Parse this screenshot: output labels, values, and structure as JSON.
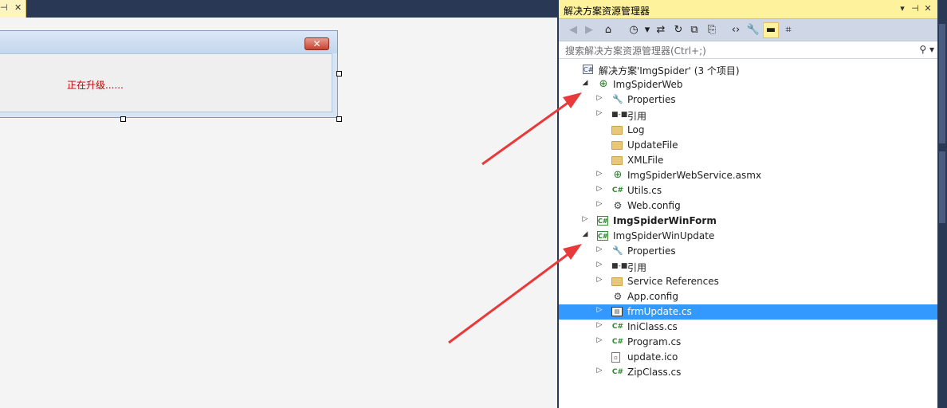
{
  "editor": {
    "tab_pin": "⊣",
    "tab_close": "✕",
    "form": {
      "close_button": "✕",
      "status_text": "正在升级......"
    }
  },
  "solution_explorer": {
    "title": "解决方案资源管理器",
    "title_buttons": {
      "dropdown": "▾",
      "pin": "⊣",
      "close": "✕"
    },
    "toolbar": [
      {
        "name": "back-icon",
        "glyph": "◀",
        "enabled": false
      },
      {
        "name": "forward-icon",
        "glyph": "▶",
        "enabled": false
      },
      {
        "name": "home-icon",
        "glyph": "⌂",
        "enabled": true
      },
      {
        "name": "pending-changes-icon",
        "glyph": "◷",
        "enabled": true
      },
      {
        "name": "dropdown-arrow-icon",
        "glyph": "▾",
        "enabled": true
      },
      {
        "name": "sync-icon",
        "glyph": "⇄",
        "enabled": true
      },
      {
        "name": "refresh-icon",
        "glyph": "↻",
        "enabled": true
      },
      {
        "name": "collapse-all-icon",
        "glyph": "⧉",
        "enabled": true
      },
      {
        "name": "show-all-files-icon",
        "glyph": "⎘",
        "enabled": true
      },
      {
        "name": "view-code-icon",
        "glyph": "‹›",
        "enabled": true
      },
      {
        "name": "properties-wrench-icon",
        "glyph": "🔧",
        "enabled": true
      },
      {
        "name": "preview-icon",
        "glyph": "▬",
        "enabled": true,
        "active": true
      },
      {
        "name": "class-diagram-icon",
        "glyph": "⌗",
        "enabled": true
      }
    ],
    "search": {
      "placeholder": "搜索解决方案资源管理器(Ctrl+;)",
      "icon": "⚲",
      "dropdown": "▾"
    },
    "tree": [
      {
        "label": "解决方案'ImgSpider' (3 个项目)",
        "level": 0,
        "icon": "solution",
        "expander": ""
      },
      {
        "label": "ImgSpiderWeb",
        "level": 1,
        "icon": "web",
        "expander": "◢"
      },
      {
        "label": "Properties",
        "level": 2,
        "icon": "wrench",
        "expander": "▷"
      },
      {
        "label": "引用",
        "level": 2,
        "icon": "references",
        "expander": "▷"
      },
      {
        "label": "Log",
        "level": 2,
        "icon": "folder",
        "expander": ""
      },
      {
        "label": "UpdateFile",
        "level": 2,
        "icon": "folder",
        "expander": ""
      },
      {
        "label": "XMLFile",
        "level": 2,
        "icon": "folder",
        "expander": ""
      },
      {
        "label": "ImgSpiderWebService.asmx",
        "level": 2,
        "icon": "asmx",
        "expander": "▷"
      },
      {
        "label": "Utils.cs",
        "level": 2,
        "icon": "cs",
        "expander": "▷"
      },
      {
        "label": "Web.config",
        "level": 2,
        "icon": "config",
        "expander": "▷"
      },
      {
        "label": "ImgSpiderWinForm",
        "level": 1,
        "icon": "csproj",
        "expander": "▷",
        "bold": true
      },
      {
        "label": "ImgSpiderWinUpdate",
        "level": 1,
        "icon": "csproj",
        "expander": "◢"
      },
      {
        "label": "Properties",
        "level": 2,
        "icon": "wrench",
        "expander": "▷"
      },
      {
        "label": "引用",
        "level": 2,
        "icon": "references",
        "expander": "▷"
      },
      {
        "label": "Service References",
        "level": 2,
        "icon": "folder",
        "expander": "▷"
      },
      {
        "label": "App.config",
        "level": 2,
        "icon": "config",
        "expander": ""
      },
      {
        "label": "frmUpdate.cs",
        "level": 2,
        "icon": "form",
        "expander": "▷",
        "selected": true
      },
      {
        "label": "IniClass.cs",
        "level": 2,
        "icon": "cs",
        "expander": "▷"
      },
      {
        "label": "Program.cs",
        "level": 2,
        "icon": "cs",
        "expander": "▷"
      },
      {
        "label": "update.ico",
        "level": 2,
        "icon": "file",
        "expander": ""
      },
      {
        "label": "ZipClass.cs",
        "level": 2,
        "icon": "cs",
        "expander": "▷"
      }
    ]
  },
  "colors": {
    "title_bar": "#fff29d",
    "selection": "#3399ff",
    "annotation_arrow": "#e83a3a",
    "chrome_dark": "#293955"
  }
}
